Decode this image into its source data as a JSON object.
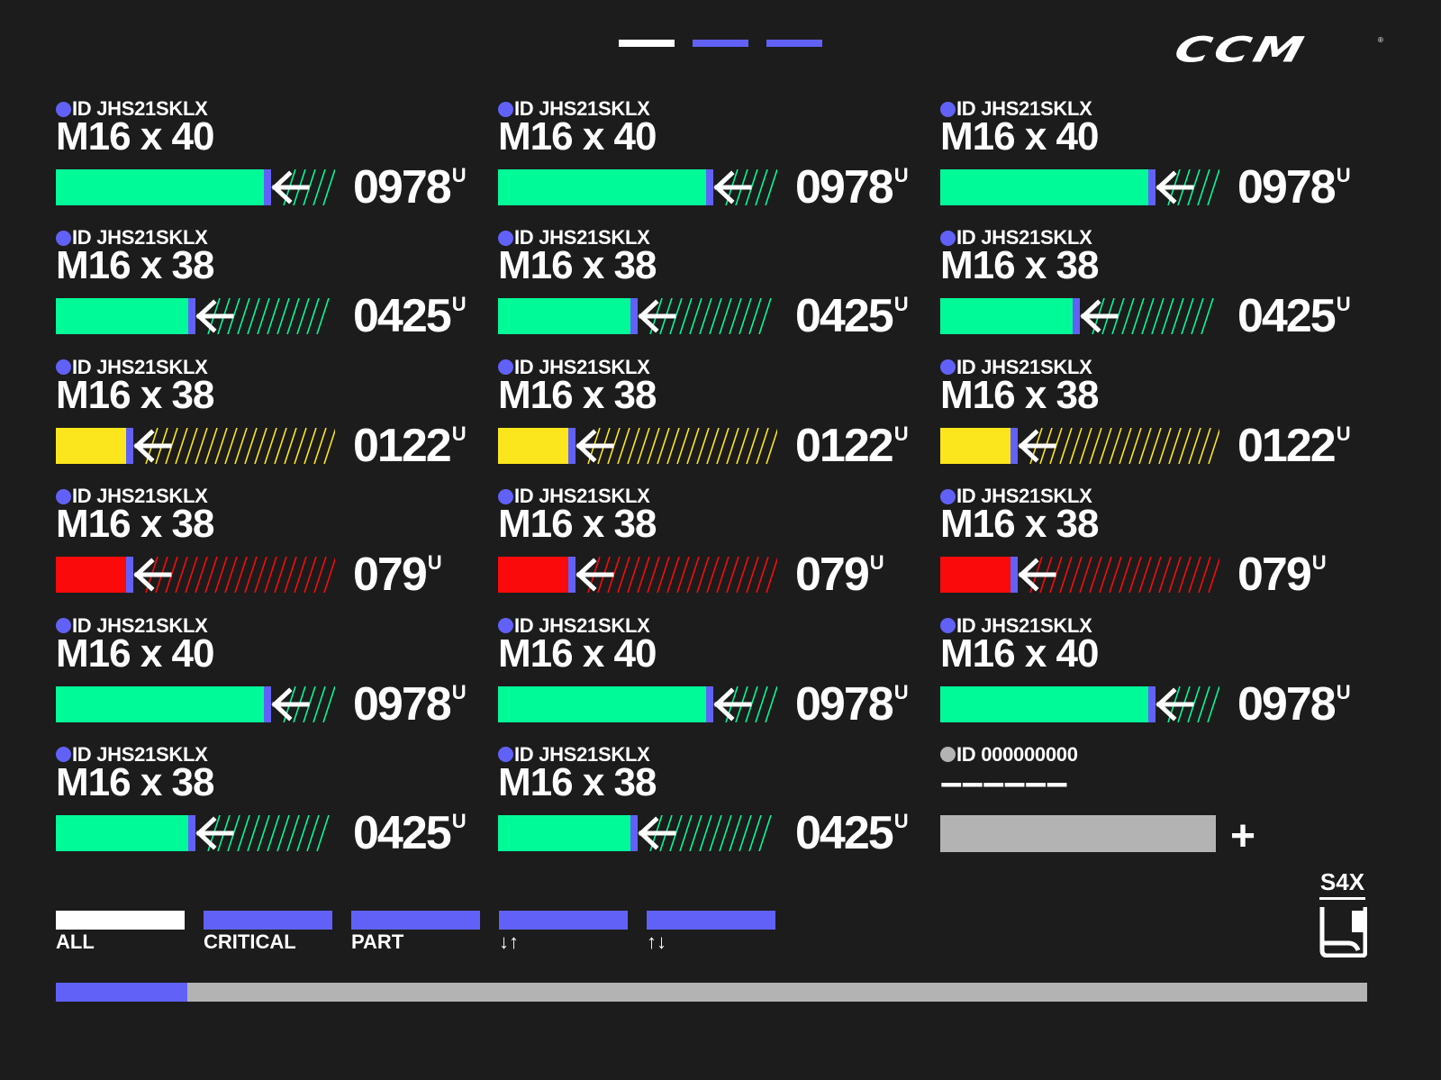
{
  "brand": {
    "logo_text": "CCM",
    "registered": "®"
  },
  "pagination": {
    "total": 3,
    "current": 0
  },
  "colors": {
    "accent": "#6161f8",
    "green": "#00fa98",
    "yellow": "#fbe51d",
    "red": "#fa0a0a",
    "empty": "#b3b3b3",
    "background": "#1c1c1c"
  },
  "cells": [
    {
      "id": "ID JHS21SKLX",
      "size": "M16 x 40",
      "count": "0978",
      "unit": "U",
      "level": 0.77,
      "status": "green"
    },
    {
      "id": "ID JHS21SKLX",
      "size": "M16 x 40",
      "count": "0978",
      "unit": "U",
      "level": 0.77,
      "status": "green"
    },
    {
      "id": "ID JHS21SKLX",
      "size": "M16 x 40",
      "count": "0978",
      "unit": "U",
      "level": 0.77,
      "status": "green"
    },
    {
      "id": "ID JHS21SKLX",
      "size": "M16 x 38",
      "count": "0425",
      "unit": "U",
      "level": 0.49,
      "status": "green"
    },
    {
      "id": "ID JHS21SKLX",
      "size": "M16 x 38",
      "count": "0425",
      "unit": "U",
      "level": 0.49,
      "status": "green"
    },
    {
      "id": "ID JHS21SKLX",
      "size": "M16 x 38",
      "count": "0425",
      "unit": "U",
      "level": 0.49,
      "status": "green"
    },
    {
      "id": "ID JHS21SKLX",
      "size": "M16 x 38",
      "count": "0122",
      "unit": "U",
      "level": 0.26,
      "status": "yellow"
    },
    {
      "id": "ID JHS21SKLX",
      "size": "M16 x 38",
      "count": "0122",
      "unit": "U",
      "level": 0.26,
      "status": "yellow"
    },
    {
      "id": "ID JHS21SKLX",
      "size": "M16 x 38",
      "count": "0122",
      "unit": "U",
      "level": 0.26,
      "status": "yellow"
    },
    {
      "id": "ID JHS21SKLX",
      "size": "M16 x 38",
      "count": "079",
      "unit": "U",
      "level": 0.26,
      "status": "red"
    },
    {
      "id": "ID JHS21SKLX",
      "size": "M16 x 38",
      "count": "079",
      "unit": "U",
      "level": 0.26,
      "status": "red"
    },
    {
      "id": "ID JHS21SKLX",
      "size": "M16 x 38",
      "count": "079",
      "unit": "U",
      "level": 0.26,
      "status": "red"
    },
    {
      "id": "ID JHS21SKLX",
      "size": "M16 x 40",
      "count": "0978",
      "unit": "U",
      "level": 0.77,
      "status": "green"
    },
    {
      "id": "ID JHS21SKLX",
      "size": "M16 x 40",
      "count": "0978",
      "unit": "U",
      "level": 0.77,
      "status": "green"
    },
    {
      "id": "ID JHS21SKLX",
      "size": "M16 x 40",
      "count": "0978",
      "unit": "U",
      "level": 0.77,
      "status": "green"
    },
    {
      "id": "ID JHS21SKLX",
      "size": "M16 x 38",
      "count": "0425",
      "unit": "U",
      "level": 0.49,
      "status": "green"
    },
    {
      "id": "ID JHS21SKLX",
      "size": "M16 x 38",
      "count": "0425",
      "unit": "U",
      "level": 0.49,
      "status": "green"
    },
    {
      "id": "ID 000000000",
      "size": "––––––",
      "add_label": "+",
      "status": "empty"
    }
  ],
  "filters": [
    {
      "label": "ALL",
      "active": true
    },
    {
      "label": "CRITICAL",
      "active": false
    },
    {
      "label": "PART",
      "active": false
    },
    {
      "label": "↓↑",
      "active": false
    },
    {
      "label": "↑↓",
      "active": false
    }
  ],
  "model": {
    "name": "S4X",
    "icon": "skate-icon"
  },
  "scroll": {
    "position": 0.1
  }
}
